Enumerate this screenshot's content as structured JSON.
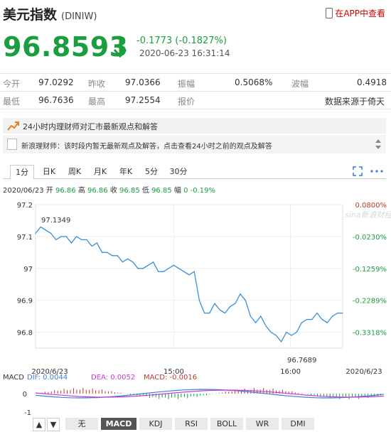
{
  "header": {
    "name": "美元指数",
    "code": "(DINIW)",
    "app_link": "在APP中查看",
    "price": "96.8593",
    "change": "-0.1773 (-0.1827%)",
    "time": "2020-06-23 16:31:14"
  },
  "stats": [
    [
      {
        "label": "今开",
        "value": "97.0292"
      },
      {
        "label": "昨收",
        "value": "97.0366"
      },
      {
        "label": "振幅",
        "value": "0.5068%"
      },
      {
        "label": "波幅",
        "value": "0.4918"
      }
    ],
    [
      {
        "label": "最低",
        "value": "96.7636"
      },
      {
        "label": "最高",
        "value": "97.2554"
      },
      {
        "label": "报价",
        "value": "数据来源于倚天"
      }
    ]
  ],
  "notice": "24小时内理财师对汇市最新观点和解答",
  "news": "新浪理财师：该时段内暂无最新观点及解答，点击查看24小时之前的观点及解答",
  "tabs": [
    "1分",
    "日K",
    "周K",
    "月K",
    "年K",
    "5分",
    "30分"
  ],
  "active_tab": "1分",
  "info_line": {
    "date": "2020/06/23",
    "open_label": "开",
    "open": "96.86",
    "high_label": "高",
    "high": "96.86",
    "close_label": "收",
    "close": "96.85",
    "low_label": "低",
    "low": "96.85",
    "pct_label": "幅",
    "pct": "0 -0.19%"
  },
  "chart_data": {
    "type": "line",
    "y_ticks": [
      "97.2",
      "97.1",
      "97",
      "96.9",
      "96.8"
    ],
    "pct_ticks": [
      "0.0800%",
      "-0.0230%",
      "-0.1259%",
      "-0.2289%",
      "-0.3318%"
    ],
    "x_labels": [
      "2020/6/23",
      "15:00",
      "16:00",
      "2020/6/23"
    ],
    "annotations": {
      "max": "97.1349",
      "min": "96.7689"
    },
    "watermark": "sina新浪财经",
    "ylim": [
      96.75,
      97.2
    ],
    "x": [
      0,
      2,
      4,
      6,
      8,
      10,
      12,
      14,
      16,
      18,
      20,
      22,
      24,
      26,
      28,
      30,
      32,
      34,
      36,
      38,
      40,
      42,
      44,
      46,
      48,
      50,
      52,
      54,
      56,
      58,
      60,
      62,
      64,
      66,
      68,
      70,
      72,
      74,
      76,
      78,
      80,
      82,
      84,
      86,
      88,
      90,
      92,
      94,
      96,
      98,
      100,
      102,
      104,
      106,
      108,
      110,
      112,
      114,
      116,
      118,
      120
    ],
    "values": [
      97.11,
      97.13,
      97.12,
      97.11,
      97.09,
      97.1,
      97.1,
      97.08,
      97.1,
      97.09,
      97.09,
      97.07,
      97.08,
      97.05,
      97.05,
      97.04,
      97.04,
      97.02,
      97.03,
      97.02,
      97.0,
      97.0,
      97.01,
      97.02,
      96.99,
      96.99,
      97.0,
      97.01,
      97.0,
      96.99,
      96.98,
      96.99,
      96.9,
      96.86,
      96.86,
      96.89,
      96.87,
      96.86,
      96.88,
      96.89,
      96.92,
      96.9,
      96.85,
      96.83,
      96.85,
      96.82,
      96.8,
      96.79,
      96.77,
      96.8,
      96.79,
      96.8,
      96.83,
      96.84,
      96.84,
      96.86,
      96.84,
      96.83,
      96.85,
      96.86,
      96.86
    ]
  },
  "macd": {
    "label": "MACD",
    "dif": "DIF: 0.0044",
    "dea": "DEA: 0.0052",
    "macd": "MACD: -0.0016",
    "ticks": [
      "0",
      "-1"
    ],
    "dif_color": "#3b7fd6",
    "dea_color": "#c83bd6",
    "macd_color": "#c0392b"
  },
  "indicator_tabs": [
    "无",
    "MACD",
    "KDJ",
    "RSI",
    "BOLL",
    "WR",
    "DMI"
  ],
  "active_indicator": "MACD",
  "colors": {
    "down": "#1a9e3f",
    "up": "#c0392b",
    "line": "#3a8fd9"
  }
}
